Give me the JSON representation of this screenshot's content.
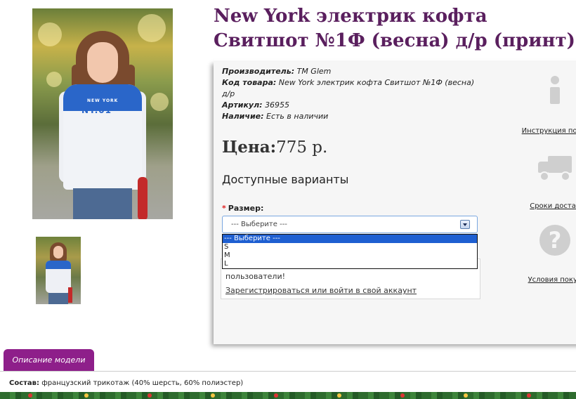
{
  "product": {
    "title": "New York электрик кофта Свитшот №1Ф (весна) д/р (принт)",
    "photo_print_top": "NEW YORK",
    "photo_print": "NY.01",
    "manufacturer_label": "Производитель:",
    "manufacturer_value": "TM Glem",
    "code_label": "Код товара:",
    "code_value": "New York электрик кофта Свитшот №1Ф (весна) д/р",
    "sku_label": "Артикул:",
    "sku_value": "36955",
    "availability_label": "Наличие:",
    "availability_value": "Есть в наличии",
    "price_label": "Цена:",
    "price_value": "775 р."
  },
  "options": {
    "heading": "Доступные варианты",
    "size_label": "Размер:",
    "required_mark": "*",
    "selected": "--- Выберите ---",
    "items": [
      "--- Выберите ---",
      "S",
      "M",
      "L"
    ]
  },
  "notice": {
    "line": "пользователи!",
    "link": "Зарегистрироваться или войти в свой аккаунт"
  },
  "side_links": {
    "instruction": "Инструкция по по",
    "delivery": "Сроки достав",
    "purchase": "Условия покуп"
  },
  "description": {
    "tab_label": "Описание модели",
    "composition_label": "Состав:",
    "composition_value": "французский трикотаж (40% шерсть, 60% полиэстер)"
  },
  "colors": {
    "title": "#5a1f5e",
    "tab": "#8e1f8a",
    "dropdown_selected": "#1e5fd1",
    "required": "#e02020"
  }
}
